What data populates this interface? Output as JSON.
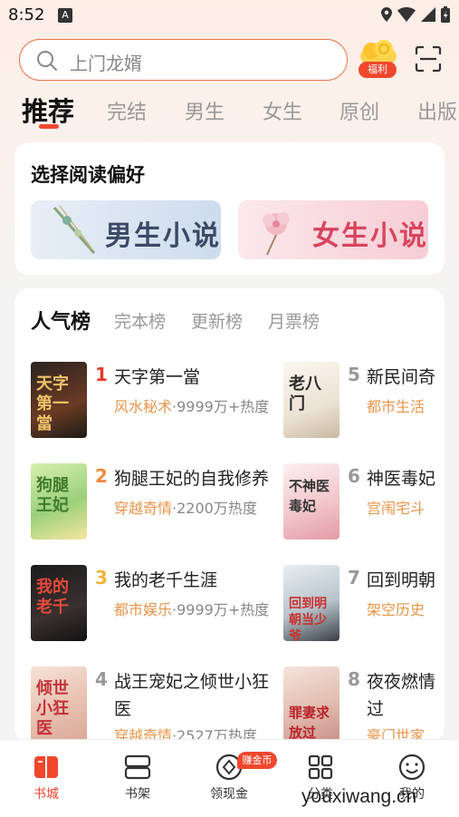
{
  "status_bar": {
    "time": "8:52",
    "notification_letter": "A"
  },
  "search": {
    "placeholder": "上门龙婿"
  },
  "welfare": {
    "label": "福利"
  },
  "tabs": [
    "推荐",
    "完结",
    "男生",
    "女生",
    "原创",
    "出版"
  ],
  "preference": {
    "title": "选择阅读偏好",
    "male_label": "男生小说",
    "female_label": "女生小说"
  },
  "ranking": {
    "tabs": [
      "人气榜",
      "完本榜",
      "更新榜",
      "月票榜"
    ],
    "books": [
      {
        "rank": "1",
        "title": "天字第一當",
        "genre": "风水秘术",
        "heat": "·9999万+热度",
        "cover_text": "天字第一當"
      },
      {
        "rank": "2",
        "title": "狗腿王妃的自我修养",
        "genre": "穿越奇情",
        "heat": "·2200万热度",
        "cover_text": "狗腿王妃"
      },
      {
        "rank": "3",
        "title": "我的老千生涯",
        "genre": "都市娱乐",
        "heat": "·9999万+热度",
        "cover_text": "我的老千"
      },
      {
        "rank": "4",
        "title": "战王宠妃之倾世小狂医",
        "genre": "穿越奇情",
        "heat": "·2527万热度",
        "cover_text": "倾世小狂医"
      },
      {
        "rank": "5",
        "title": "新民间奇",
        "genre": "都市生活",
        "heat": "",
        "cover_text": "老八门"
      },
      {
        "rank": "6",
        "title": "神医毒妃",
        "genre": "宫闱宅斗",
        "heat": "",
        "cover_text": "不神医毒妃"
      },
      {
        "rank": "7",
        "title": "回到明朝",
        "genre": "架空历史",
        "heat": "",
        "cover_text": "回到明朝当少爷"
      },
      {
        "rank": "8",
        "title": "夜夜燃情过",
        "genre": "豪门世家",
        "heat": "",
        "cover_text": "罪妻求放过"
      }
    ]
  },
  "bottom_nav": {
    "items": [
      "书城",
      "书架",
      "领现金",
      "分类",
      "我的"
    ],
    "earn_badge": "赚金币"
  },
  "watermark": "youxiwang.cn",
  "colors": {
    "accent": "#f0472e",
    "genre": "#e8954a",
    "rank_1": "#e43c2f",
    "rank_2": "#f08a3a",
    "rank_3": "#f0b43a",
    "rank_other": "#999999"
  }
}
